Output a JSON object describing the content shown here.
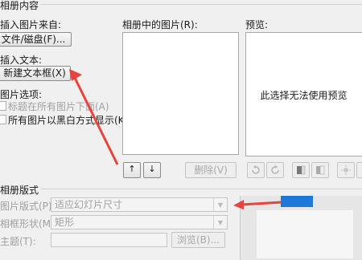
{
  "album_content": {
    "title": "相册内容",
    "insert_from": "插入图片来自:",
    "file_disk_button": "文件/磁盘(F)...",
    "insert_text": "插入文本:",
    "new_textbox_button": "新建文本框(X)",
    "picture_options": "图片选项:",
    "option_caption": "标题在所有图片下面(A)",
    "option_bw": "所有图片以黑白方式显示(K)"
  },
  "pictures_in_album": {
    "label": "相册中的图片(R):",
    "up_arrow": "↑",
    "down_arrow": "↓",
    "remove_button": "删除(V)"
  },
  "preview": {
    "label": "预览:",
    "message": "此选择无法使用预览"
  },
  "album_layout": {
    "title": "相册版式",
    "picture_layout_label": "图片版式(P):",
    "picture_layout_value": "适应幻灯片尺寸",
    "frame_shape_label": "相框形状(M):",
    "frame_shape_value": "矩形",
    "theme_label": "主题(T):",
    "theme_value": "",
    "browse_button": "浏览(B)..."
  },
  "colors": {
    "arrow_red": "#e8433c",
    "dialog_bg": "#f0f0f0",
    "panel_bg": "#ffffff",
    "blue_accent": "#1e78d7"
  }
}
